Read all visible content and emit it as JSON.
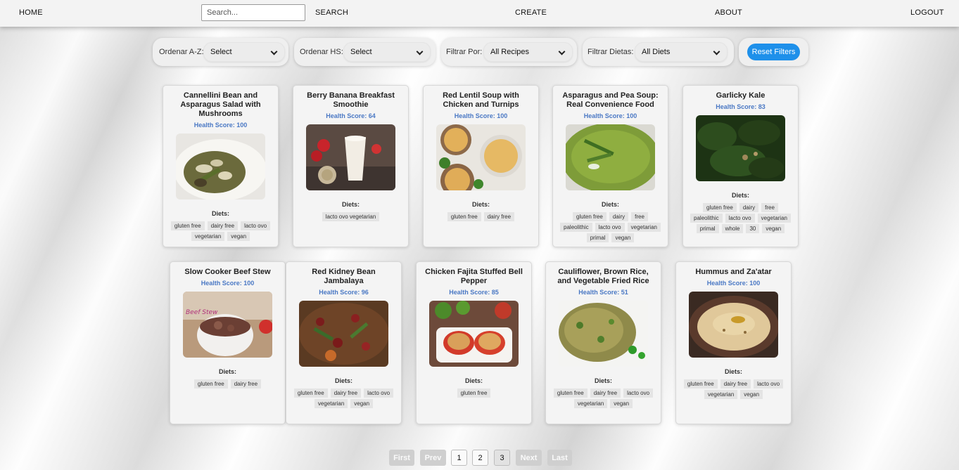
{
  "nav": {
    "home": "HOME",
    "search_placeholder": "Search...",
    "search": "SEARCH",
    "create": "CREATE",
    "about": "ABOUT",
    "logout": "LOGOUT"
  },
  "filters": {
    "order_az": {
      "label": "Ordenar A-Z:",
      "value": "Select"
    },
    "order_hs": {
      "label": "Ordenar HS:",
      "value": "Select"
    },
    "filter_by": {
      "label": "Filtrar Por:",
      "value": "All Recipes"
    },
    "filter_diets": {
      "label": "Filtrar Dietas:",
      "value": "All Diets"
    },
    "reset": "Reset Filters"
  },
  "diets_label": "Diets:",
  "cards": [
    {
      "title": "Cannellini Bean and Asparagus Salad with Mushrooms",
      "score": "Health Score: 100",
      "diets": [
        "gluten free",
        "dairy free",
        "lacto ovo",
        "vegetarian",
        "vegan"
      ]
    },
    {
      "title": "Berry Banana Breakfast Smoothie",
      "score": "Health Score: 64",
      "diets": [
        "lacto ovo vegetarian"
      ]
    },
    {
      "title": "Red Lentil Soup with Chicken and Turnips",
      "score": "Health Score: 100",
      "diets": [
        "gluten free",
        "dairy free"
      ]
    },
    {
      "title": "Asparagus and Pea Soup: Real Convenience Food",
      "score": "Health Score: 100",
      "diets": [
        "gluten free",
        "dairy",
        "free",
        "paleolithic",
        "lacto ovo",
        "vegetarian",
        "primal",
        "vegan"
      ]
    },
    {
      "title": "Garlicky Kale",
      "score": "Health Score: 83",
      "diets": [
        "gluten free",
        "dairy",
        "free",
        "paleolithic",
        "lacto ovo",
        "vegetarian",
        "primal",
        "whole",
        "30",
        "vegan"
      ]
    },
    {
      "title": "Slow Cooker Beef Stew",
      "score": "Health Score: 100",
      "diets": [
        "gluten free",
        "dairy free"
      ]
    },
    {
      "title": "Red Kidney Bean Jambalaya",
      "score": "Health Score: 96",
      "diets": [
        "gluten free",
        "dairy free",
        "lacto ovo",
        "vegetarian",
        "vegan"
      ]
    },
    {
      "title": "Chicken Fajita Stuffed Bell Pepper",
      "score": "Health Score: 85",
      "diets": [
        "gluten free"
      ]
    },
    {
      "title": "Cauliflower, Brown Rice, and Vegetable Fried Rice",
      "score": "Health Score: 51",
      "diets": [
        "gluten free",
        "dairy free",
        "lacto ovo",
        "vegetarian",
        "vegan"
      ]
    },
    {
      "title": "Hummus and Za'atar",
      "score": "Health Score: 100",
      "diets": [
        "gluten free",
        "dairy free",
        "lacto ovo",
        "vegetarian",
        "vegan"
      ]
    }
  ],
  "image_texts": {
    "beef_stew": "Beef Stew"
  },
  "pagination": {
    "first": "First",
    "prev": "Prev",
    "pages": [
      "1",
      "2",
      "3"
    ],
    "current": "3",
    "next": "Next",
    "last": "Last"
  },
  "colors": {
    "accent": "#1e90ea",
    "score": "#4a78c4"
  }
}
